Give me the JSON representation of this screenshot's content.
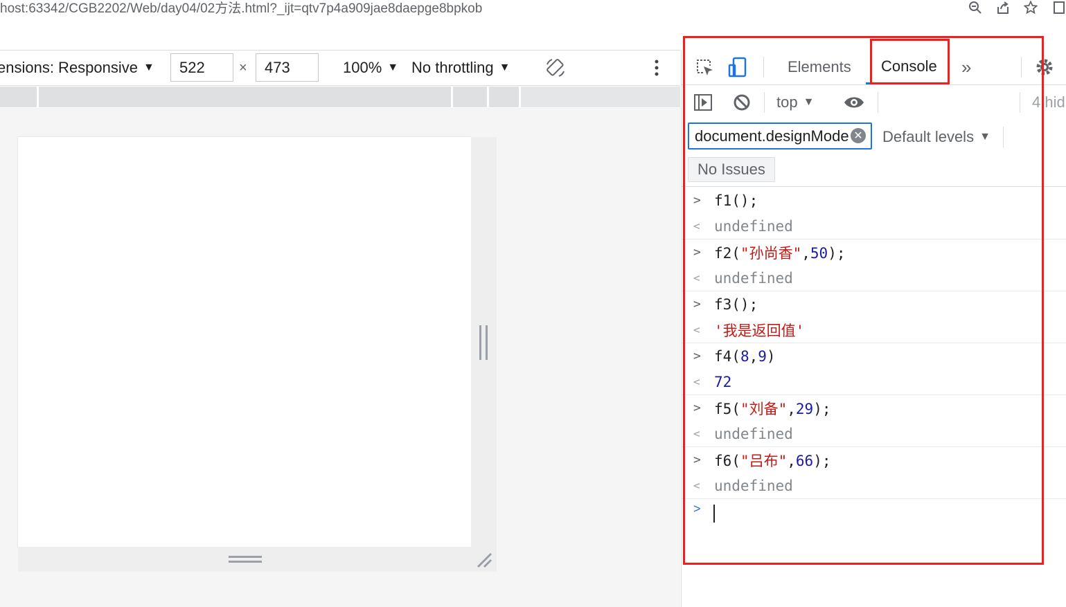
{
  "address_bar": {
    "url": "host:63342/CGB2202/Web/day04/02方法.html?_ijt=qtv7p4a909jae8daepge8bpkob"
  },
  "device_toolbar": {
    "dimensions_label": "ensions: Responsive",
    "width": "522",
    "times": "×",
    "height": "473",
    "zoom": "100%",
    "throttling": "No throttling"
  },
  "devtools": {
    "tabs": {
      "elements": "Elements",
      "console": "Console",
      "more": "»"
    },
    "toolbar": {
      "context": "top",
      "hidden": "4 hid"
    },
    "filter": {
      "value": "document.designMode"
    },
    "levels": "Default levels",
    "issues": "No Issues",
    "console_entries": [
      {
        "input": [
          {
            "t": "f1();",
            "c": ""
          }
        ],
        "output": [
          {
            "t": "undefined",
            "c": "undef"
          }
        ]
      },
      {
        "input": [
          {
            "t": "f2(",
            "c": ""
          },
          {
            "t": "\"孙尚香\"",
            "c": "str"
          },
          {
            "t": ",",
            "c": ""
          },
          {
            "t": "50",
            "c": "num"
          },
          {
            "t": ");",
            "c": ""
          }
        ],
        "output": [
          {
            "t": "undefined",
            "c": "undef"
          }
        ]
      },
      {
        "input": [
          {
            "t": "f3();",
            "c": ""
          }
        ],
        "output": [
          {
            "t": "'我是返回值'",
            "c": "str"
          }
        ]
      },
      {
        "input": [
          {
            "t": "f4(",
            "c": ""
          },
          {
            "t": "8",
            "c": "num"
          },
          {
            "t": ",",
            "c": ""
          },
          {
            "t": "9",
            "c": "num"
          },
          {
            "t": ")",
            "c": ""
          }
        ],
        "output": [
          {
            "t": "72",
            "c": "num"
          }
        ]
      },
      {
        "input": [
          {
            "t": "f5(",
            "c": ""
          },
          {
            "t": "\"刘备\"",
            "c": "str"
          },
          {
            "t": ",",
            "c": ""
          },
          {
            "t": "29",
            "c": "num"
          },
          {
            "t": ");",
            "c": ""
          }
        ],
        "output": [
          {
            "t": "undefined",
            "c": "undef"
          }
        ]
      },
      {
        "input": [
          {
            "t": "f6(",
            "c": ""
          },
          {
            "t": "\"吕布\"",
            "c": "str"
          },
          {
            "t": ",",
            "c": ""
          },
          {
            "t": "66",
            "c": "num"
          },
          {
            "t": ");",
            "c": ""
          }
        ],
        "output": [
          {
            "t": "undefined",
            "c": "undef"
          }
        ]
      }
    ]
  },
  "colors": {
    "accent": "#1a73e8",
    "annotation_red": "#f01f1f",
    "string": "#c41a16",
    "number": "#1a1aa6"
  }
}
